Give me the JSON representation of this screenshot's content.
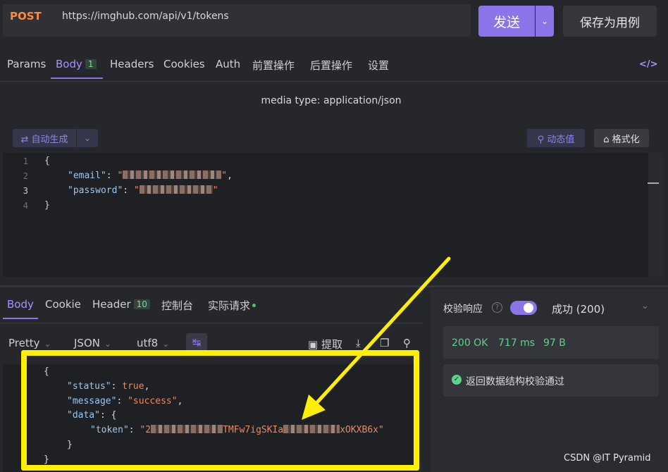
{
  "request": {
    "method": "POST",
    "url": "https://imghub.com/api/v1/tokens",
    "send_label": "发送",
    "save_label": "保存为用例"
  },
  "request_tabs": [
    {
      "label": "Params"
    },
    {
      "label": "Body",
      "count": "1"
    },
    {
      "label": "Headers"
    },
    {
      "label": "Cookies"
    },
    {
      "label": "Auth"
    },
    {
      "label": "前置操作"
    },
    {
      "label": "后置操作"
    },
    {
      "label": "设置"
    }
  ],
  "code_icon": "code-brackets-icon",
  "media_type": "media type: application/json",
  "editor_toolbar": {
    "auto_generate": "⇄ 自动生成",
    "dynamic_value": "⚲ 动态值",
    "format": "⌂ 格式化"
  },
  "request_body": {
    "line_numbers": [
      "1",
      "2",
      "3",
      "4"
    ],
    "open": "{",
    "close": "}",
    "email_key": "\"email\"",
    "password_key": "\"password\""
  },
  "response_tabs": [
    {
      "label": "Body"
    },
    {
      "label": "Cookie"
    },
    {
      "label": "Header",
      "count": "10"
    },
    {
      "label": "控制台"
    },
    {
      "label": "实际请求"
    }
  ],
  "response_controls": {
    "pretty": "Pretty",
    "format": "JSON",
    "encoding": "utf8",
    "extract": "提取"
  },
  "response_body": {
    "open": "{",
    "status_key": "\"status\"",
    "status_val": "true",
    "message_key": "\"message\"",
    "message_val": "\"success\"",
    "data_key": "\"data\"",
    "token_key": "\"token\"",
    "token_prefix": "\"2",
    "token_mid": "TMFw7igSKIa",
    "token_suffix": "xOKXB6x\"",
    "inner_close": "}",
    "outer_close": "}"
  },
  "validation": {
    "label": "校验响应",
    "result": "成功 (200)",
    "toggle_on": true,
    "message": "返回数据结构校验通过"
  },
  "stats": {
    "status": "200 OK",
    "time": "717 ms",
    "size": "97 B"
  },
  "watermark": "CSDN @IT Pyramid",
  "colors": {
    "accent": "#8a74e8",
    "success": "#5fd18a",
    "method": "#ff8a3c",
    "highlight": "#ffef00"
  }
}
